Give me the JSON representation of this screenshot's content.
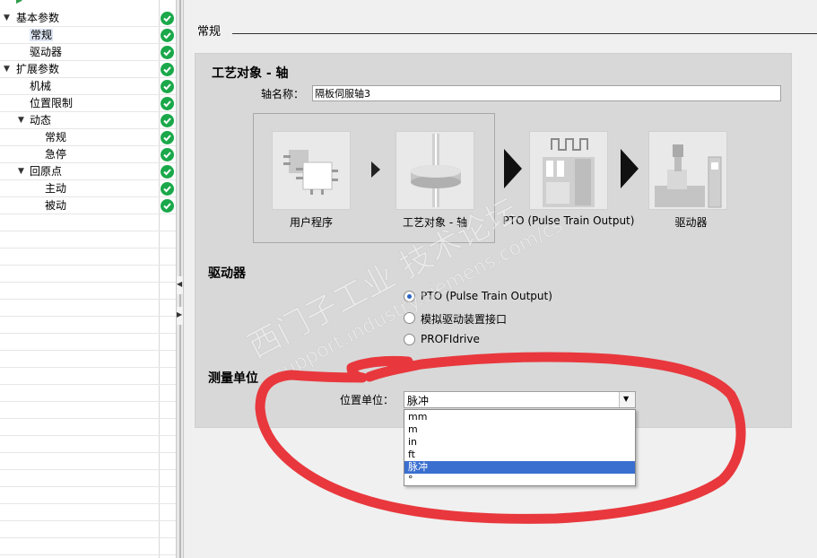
{
  "tree": {
    "items": [
      {
        "label": "基本参数",
        "level": 0,
        "expanded": true,
        "status": "ok"
      },
      {
        "label": "常规",
        "level": 1,
        "selected": true,
        "status": "ok"
      },
      {
        "label": "驱动器",
        "level": 1,
        "status": "ok"
      },
      {
        "label": "扩展参数",
        "level": 0,
        "expanded": true,
        "status": "ok"
      },
      {
        "label": "机械",
        "level": 1,
        "status": "ok"
      },
      {
        "label": "位置限制",
        "level": 1,
        "status": "ok"
      },
      {
        "label": "动态",
        "level": 1,
        "expanded": true,
        "status": "ok"
      },
      {
        "label": "常规",
        "level": 2,
        "status": "ok"
      },
      {
        "label": "急停",
        "level": 2,
        "status": "ok"
      },
      {
        "label": "回原点",
        "level": 1,
        "expanded": true,
        "status": "ok"
      },
      {
        "label": "主动",
        "level": 2,
        "status": "ok"
      },
      {
        "label": "被动",
        "level": 2,
        "status": "ok"
      }
    ]
  },
  "section": {
    "title": "常规"
  },
  "tech_object": {
    "heading": "工艺对象 - 轴",
    "axis_name_label": "轴名称：",
    "axis_name_value": "隔板伺服轴3"
  },
  "flow": {
    "steps": [
      {
        "label": "用户程序"
      },
      {
        "label": "工艺对象 - 轴"
      },
      {
        "label": "PTO (Pulse Train Output)"
      },
      {
        "label": "驱动器"
      }
    ]
  },
  "drive": {
    "heading": "驱动器",
    "options": [
      {
        "label": "PTO (Pulse Train Output)",
        "checked": true
      },
      {
        "label": "模拟驱动装置接口",
        "checked": false
      },
      {
        "label": "PROFIdrive",
        "checked": false
      }
    ]
  },
  "units": {
    "heading": "测量单位",
    "position_label": "位置单位：",
    "selected": "脉冲",
    "options": [
      "mm",
      "m",
      "in",
      "ft",
      "脉冲",
      "°"
    ]
  },
  "watermark": {
    "line1": "西门子工业  技术论坛",
    "line2": "support.industry.siemens.com/cs"
  },
  "colors": {
    "status_ok": "#1aa84a",
    "selection": "#3a6fd0",
    "annotation": "#e8383d"
  }
}
